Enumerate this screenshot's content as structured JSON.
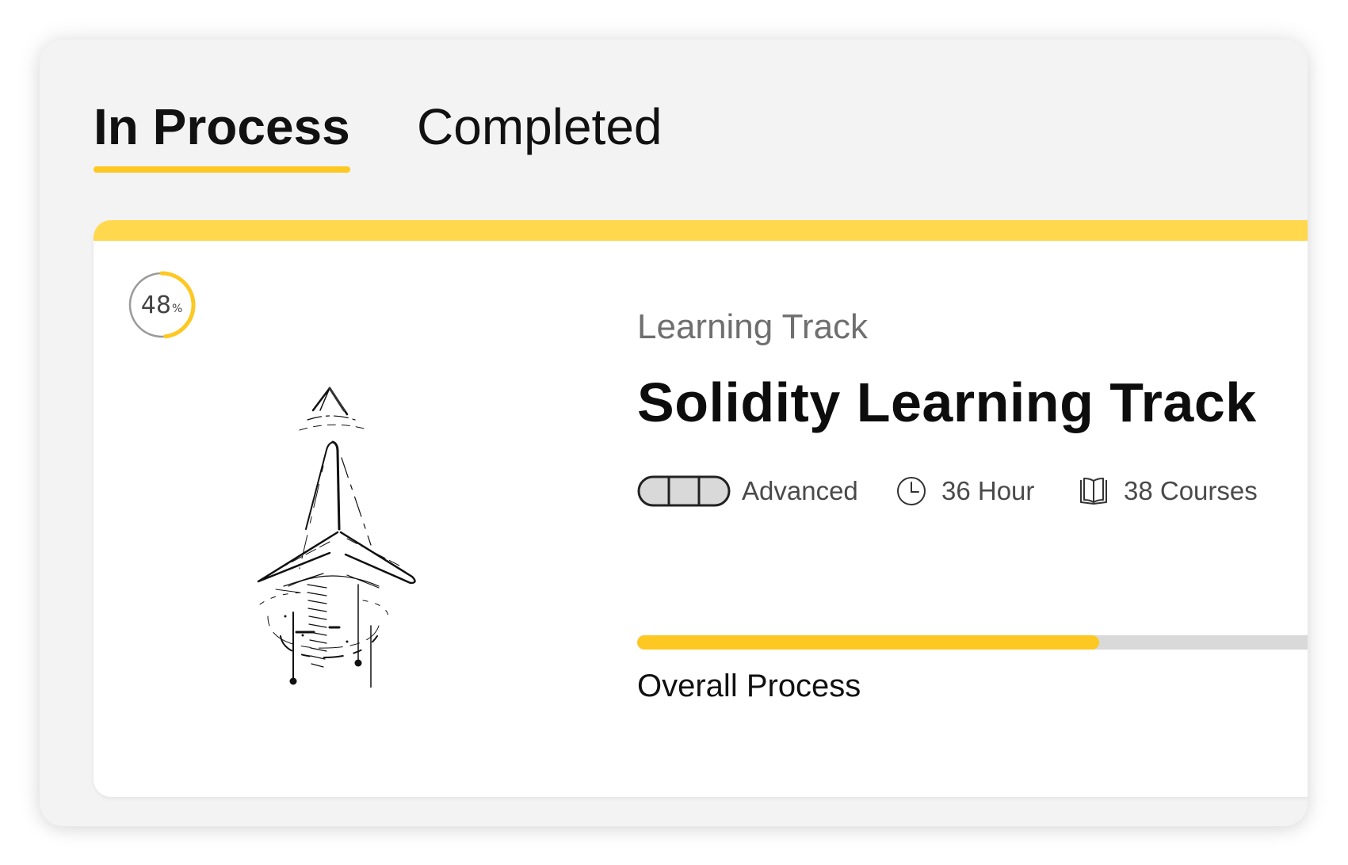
{
  "tabs": {
    "in_process": "In Process",
    "completed": "Completed",
    "active": "in_process"
  },
  "card": {
    "progress_percent": "48",
    "percent_sign": "%",
    "overline": "Learning Track",
    "title": "Solidity Learning Track",
    "meta": {
      "level": "Advanced",
      "duration": "36 Hour",
      "courses": "38 Courses"
    },
    "overall_progress_fraction": 0.663,
    "overall_progress_label": "Overall Process"
  },
  "icons": {
    "level": "difficulty-bars-icon",
    "duration": "clock-icon",
    "courses": "book-icon",
    "illustration": "rocket-launch-illustration"
  },
  "colors": {
    "accent": "#fdc822",
    "accent_light": "#ffd84d",
    "frame_bg": "#f3f3f3",
    "card_bg": "#ffffff",
    "track_bg": "#d9d9d9",
    "text_dark": "#111111",
    "text_muted": "#6f6f6f"
  }
}
